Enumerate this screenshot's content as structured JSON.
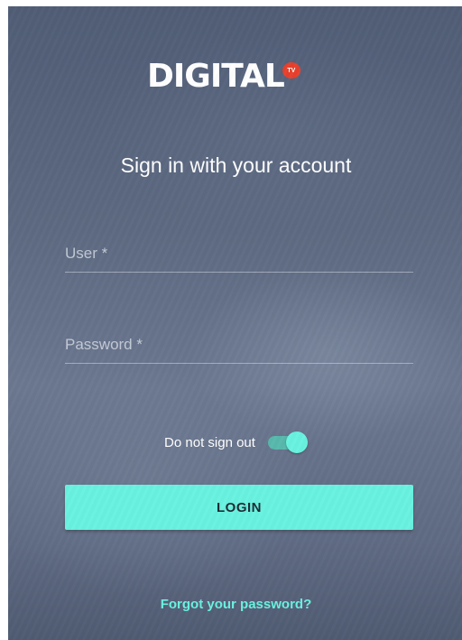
{
  "brand": {
    "logo_text": "DIGITAL",
    "badge_text": "TV",
    "badge_color": "#e8402c"
  },
  "title": "Sign in with your account",
  "form": {
    "user_placeholder": "User *",
    "user_value": "",
    "password_placeholder": "Password *",
    "password_value": ""
  },
  "stay_signed": {
    "label": "Do not sign out",
    "enabled": true
  },
  "login_label": "LOGIN",
  "forgot_label": "Forgot your password?",
  "colors": {
    "accent": "#69f2df",
    "background": "#5d6a81",
    "text": "#ffffff"
  }
}
